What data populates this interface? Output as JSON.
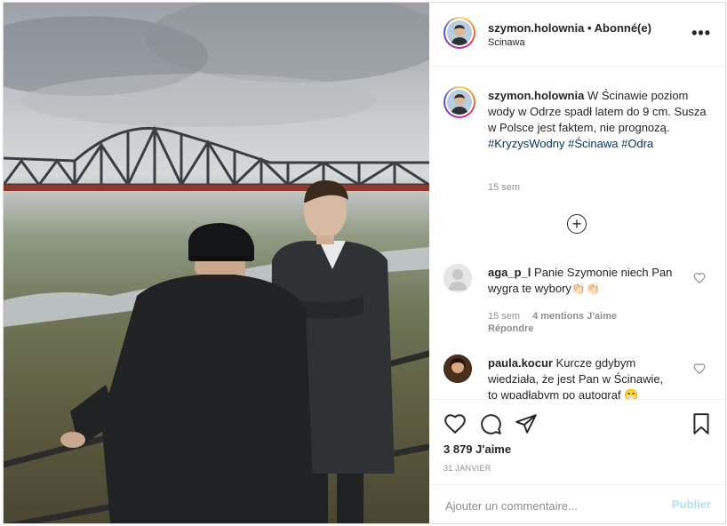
{
  "post": {
    "username": "szymon.holownia",
    "separator": "•",
    "follow_status": "Abonné(e)",
    "location": "Scinawa",
    "more_label": "•••"
  },
  "caption": {
    "username": "szymon.holownia",
    "text": " W Ścinawie poziom wody w Odrze spadł latem do 9 cm. Susza w Polsce jest faktem, nie prognozą. ",
    "hashtags": [
      "#KryzysWodny",
      "#Ścinawa",
      "#Odra"
    ],
    "time": "15 sem"
  },
  "load_more_label": "+",
  "comments": [
    {
      "username": "aga_p_l",
      "text": " Panie Szymonie niech Pan wygra te wybory👏🏻👏🏻",
      "time": "15 sem",
      "likes": "4 mentions J'aime",
      "reply": "Répondre"
    },
    {
      "username": "paula.kocur",
      "text": " Kurcze gdybym wiedziała, że jest Pan w Ścinawie, to wpadłabym po autograf 😁"
    }
  ],
  "actions": {
    "like_icon": "heart-icon",
    "comment_icon": "comment-icon",
    "share_icon": "paper-plane-icon",
    "save_icon": "bookmark-icon"
  },
  "likes_count": "3 879 J'aime",
  "date": "31 JANVIER",
  "add_comment": {
    "placeholder": "Ajouter un commentaire...",
    "publish_label": "Publier"
  },
  "colors": {
    "hashtag": "#00376b",
    "publish_disabled": "#b2dffc",
    "muted": "#8e8e8e"
  }
}
